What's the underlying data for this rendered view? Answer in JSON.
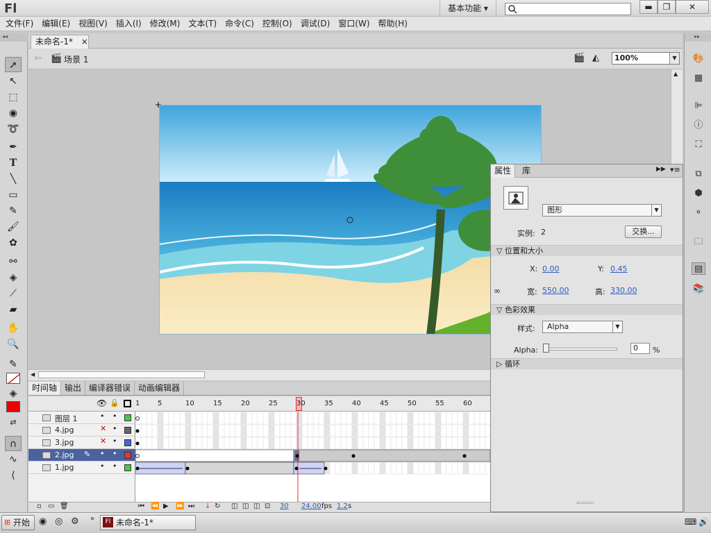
{
  "app": {
    "logo": "Fl",
    "workspace": "基本功能 ▾"
  },
  "window": {
    "min": "▬",
    "restore": "❐",
    "close": "✕"
  },
  "menu": [
    "文件(F)",
    "编辑(E)",
    "视图(V)",
    "插入(I)",
    "修改(M)",
    "文本(T)",
    "命令(C)",
    "控制(O)",
    "调试(D)",
    "窗口(W)",
    "帮助(H)"
  ],
  "document": {
    "tab": "未命名-1*",
    "tab_close": "×",
    "scene": "场景 1",
    "zoom": "100%"
  },
  "timeline": {
    "tabs": [
      "时间轴",
      "输出",
      "编译器错误",
      "动画编辑器"
    ],
    "ruler": [
      "1",
      "5",
      "10",
      "15",
      "20",
      "25",
      "30",
      "35",
      "40",
      "45",
      "50",
      "55",
      "60"
    ],
    "layers": [
      {
        "name": "图层 1",
        "hidden": false,
        "color": "#44cc44"
      },
      {
        "name": "4.jpg",
        "hidden": true,
        "color": "#666666"
      },
      {
        "name": "3.jpg",
        "hidden": true,
        "color": "#4466dd"
      },
      {
        "name": "2.jpg",
        "hidden": false,
        "color": "#ee3333",
        "selected": true
      },
      {
        "name": "1.jpg",
        "hidden": false,
        "color": "#44cc44"
      }
    ],
    "footer": {
      "frame": "30",
      "fps": "24.00",
      "fps_unit": "fps",
      "time": "1.2",
      "time_unit": "s"
    }
  },
  "properties": {
    "tabs": [
      "属性",
      "库"
    ],
    "type": "图形",
    "instance_label": "实例:",
    "instance_value": "2",
    "swap": "交换...",
    "sect_pos": "位置和大小",
    "x_label": "X:",
    "x": "0.00",
    "y_label": "Y:",
    "y": "0.45",
    "w_label": "宽:",
    "w": "550.00",
    "h_label": "高:",
    "h": "330.00",
    "sect_color": "色彩效果",
    "style_label": "样式:",
    "style": "Alpha",
    "alpha_label": "Alpha:",
    "alpha": "0",
    "alpha_unit": "%",
    "sect_loop": "循环"
  },
  "taskbar": {
    "start": "开始",
    "app": "未命名-1*"
  },
  "colors": {
    "stroke": "#cc2222",
    "fill": "#ee0000"
  }
}
